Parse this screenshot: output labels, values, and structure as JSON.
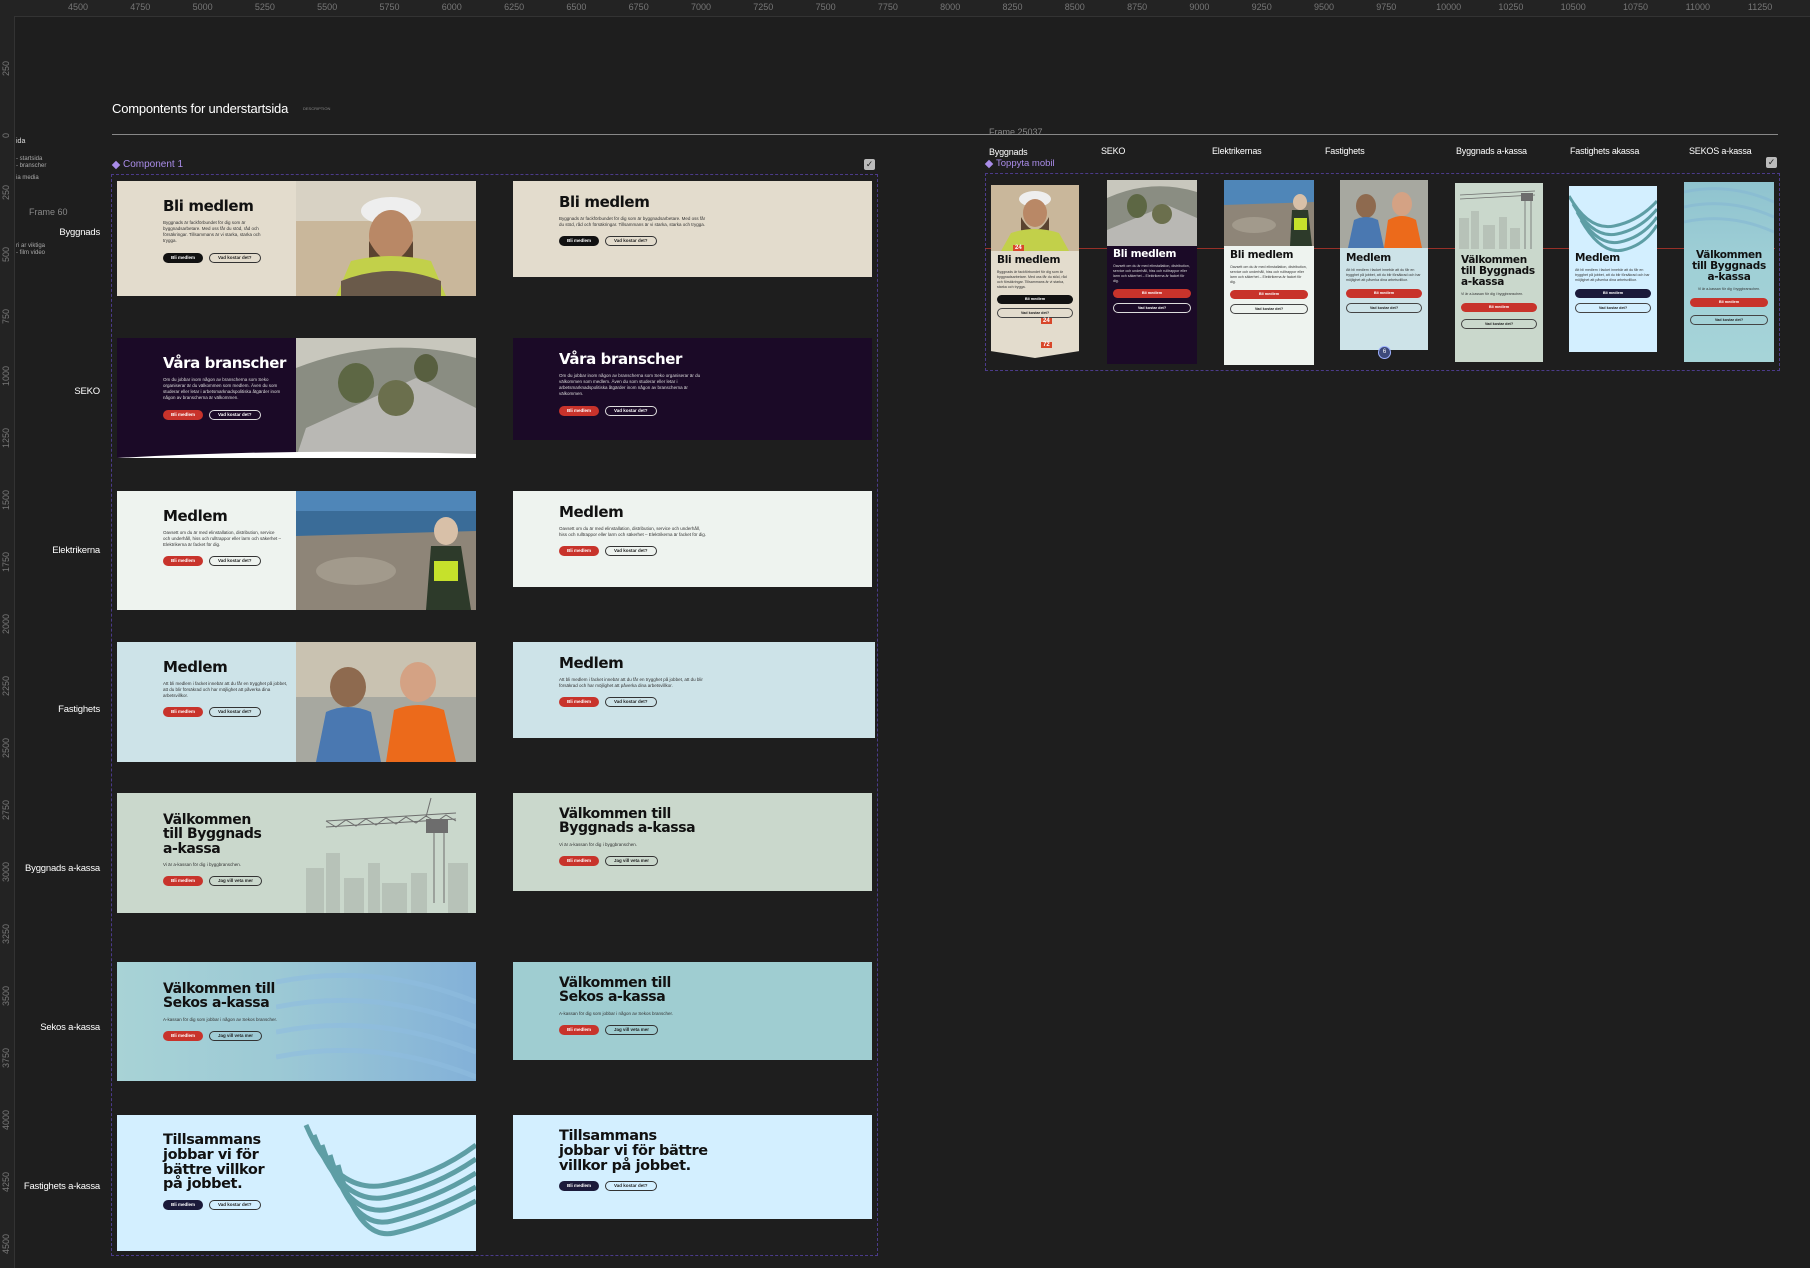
{
  "ruler": {
    "top": [
      "4500",
      "4750",
      "5000",
      "5250",
      "5500",
      "5750",
      "6000",
      "6250",
      "6500",
      "6750",
      "7000",
      "7250",
      "7500",
      "7750",
      "8000",
      "8250",
      "8500",
      "8750",
      "9000",
      "9250",
      "9500",
      "9750",
      "10000",
      "10250",
      "10500",
      "10750",
      "11000",
      "11250"
    ],
    "left": [
      "250",
      "0",
      "250",
      "500",
      "750",
      "1000",
      "1250",
      "1500",
      "1750",
      "2000",
      "2250",
      "2500",
      "2750",
      "3000",
      "3250",
      "3500",
      "3750",
      "4000",
      "4250",
      "4500"
    ]
  },
  "layers": [
    "ida",
    "- startsida",
    "- branscher",
    "ia media",
    "ri ar viktiga",
    "- film video"
  ],
  "page": {
    "title": "Compontents for understartsida",
    "description": "DESCRIPTION"
  },
  "frames": {
    "left": "Frame 60",
    "right": "Frame 25037"
  },
  "component": {
    "label": "Component 1"
  },
  "mobile_component": {
    "label": "Toppyta mobil"
  },
  "rows": [
    "Byggnads",
    "SEKO",
    "Elektrikerna",
    "Fastighets",
    "Byggnads a-kassa",
    "Sekos a-kassa",
    "Fastighets a-kassa"
  ],
  "columns": [
    "Byggnads",
    "SEKO",
    "Elektrikernas",
    "Fastighets",
    "Byggnads a-kassa",
    "Fastighets akassa",
    "SEKOS a-kassa"
  ],
  "colors": {
    "canvas": "#1e1e1e",
    "byggnads_bg": "#e3dccd",
    "seko_bg": "#1b0a27",
    "el_bg": "#eef3ef",
    "fast_bg": "#cde3e8",
    "akassa_bg": "#cad8cc",
    "sekos_akassa_bg": "#9fcdd1",
    "fast_akassa_bg": "#d3efff",
    "red": "#c8332b",
    "navy": "#1b1a3a"
  },
  "banners": {
    "byggnads": {
      "title": "Bli medlem",
      "body": "Byggnads är fackförbundet för dig som är byggnadsarbetare. Med oss får du stöd, råd och försäkringar. Tillsammans är vi starka, starka och trygga.",
      "btn_primary": "Bli medlem",
      "btn_secondary": "Vad kostar det?"
    },
    "seko": {
      "title": "Våra branscher",
      "body": "Om du jobbar inom någon av branscherna som Seko organiserar är du välkommen som medlem. Även du som studerar eller letar i arbetsmarknadspolitiska åtgärder inom någon av branscherna är välkommen.",
      "btn_primary": "Bli medlem",
      "btn_secondary": "Vad kostar det?"
    },
    "el": {
      "title": "Medlem",
      "body": "Oavsett om du är med elinstallation, distribution, service och underhåll, hiss och rulltrappor eller larm och säkerhet – Elektrikerna är facket för dig.",
      "btn_primary": "Bli medlem",
      "btn_secondary": "Vad kostar det?"
    },
    "fast": {
      "title": "Medlem",
      "body": "Att bli medlem i facket innebär att du får en trygghet på jobbet, att du blir försäkrad och har möjlighet att påverka dina arbetsvillkor.",
      "btn_primary": "Bli medlem",
      "btn_secondary": "Vad kostar det?"
    },
    "bygg_akassa": {
      "title_a": "Välkommen till Byggnads a-kassa",
      "title_b": "Välkommen till Byggnads a-kassa",
      "body": "Vi är a-kassan för dig i byggbranschen.",
      "btn_primary": "Bli medlem",
      "btn_secondary": "Jag vill veta mer"
    },
    "sekos_akassa": {
      "title": "Välkommen till Sekos a-kassa",
      "body": "A-kassan för dig som jobbar i någon av Sekos branscher.",
      "btn_primary": "Bli medlem",
      "btn_secondary": "Jag vill veta mer"
    },
    "fast_akassa": {
      "title": "Tillsammans jobbar vi för bättre villkor på jobbet.",
      "btn_primary": "Bli medlem",
      "btn_secondary": "Vad kostar det?"
    }
  },
  "mobile": {
    "byggnads": {
      "title": "Bli medlem",
      "body": "Byggnads är fackförbundet för dig som är byggnadsarbetare. Med oss får du stöd, råd och försäkringar. Tillsammans är vi starka, starka och trygga.",
      "btn_primary": "Bli medlem",
      "btn_secondary": "Vad kostar det?",
      "badge_1": "24",
      "badge_2": "24",
      "badge_3": "72"
    },
    "seko": {
      "title": "Bli medlem",
      "body": "Oavsett om du är med elinstallation, distribution, service och underhåll, hiss och rulltrappor eller larm och säkerhet – Elektrikerna är facket för dig.",
      "btn_primary": "Bli medlem",
      "btn_secondary": "Vad kostar det?"
    },
    "el": {
      "title": "Bli medlem",
      "body": "Oavsett om du är med elinstallation, distribution, service och underhåll, hiss och rulltrappor eller larm och säkerhet – Elektrikerna är facket för dig.",
      "btn_primary": "Bli medlem",
      "btn_secondary": "Vad kostar det?"
    },
    "fast": {
      "title": "Medlem",
      "body": "Att bli medlem i facket innebär att du får en trygghet på jobbet, att du blir försäkrad och har möjlighet att påverka dina arbetsvillkor.",
      "btn_primary": "Bli medlem",
      "btn_secondary": "Vad kostar det?",
      "badge": "6"
    },
    "bygg_akassa": {
      "title": "Välkommen till Byggnads a-kassa",
      "body": "Vi är a-kassan för dig i byggbranschen.",
      "btn_primary": "Bli medlem",
      "btn_secondary": "Vad kostar det?"
    },
    "fast_akassa": {
      "title": "Medlem",
      "body": "Att bli medlem i facket innebär att du får en trygghet på jobbet, att du blir försäkrad och har möjlighet att påverka dina arbetsvillkor.",
      "btn_primary": "Bli medlem",
      "btn_secondary": "Vad kostar det?"
    },
    "sekos_akassa": {
      "title": "Välkommen till Byggnads a-kassa",
      "body": "Vi är a-kassan för dig i byggbranschen.",
      "btn_primary": "Bli medlem",
      "btn_secondary": "Vad kostar det?"
    }
  }
}
